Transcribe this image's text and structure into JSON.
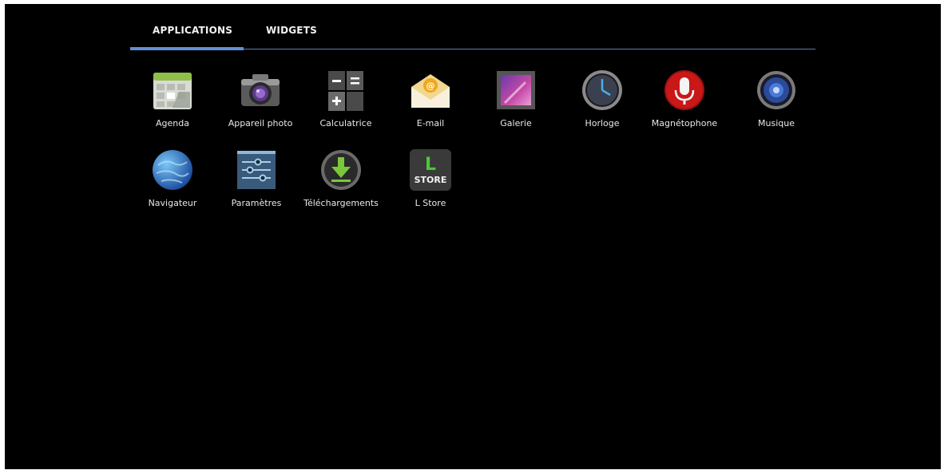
{
  "tabs": [
    {
      "label": "APPLICATIONS",
      "active": true
    },
    {
      "label": "WIDGETS",
      "active": false
    }
  ],
  "accent_color": "#5f8ed8",
  "apps": [
    {
      "label": "Agenda",
      "icon": "calendar-icon"
    },
    {
      "label": "Appareil photo",
      "icon": "camera-icon"
    },
    {
      "label": "Calculatrice",
      "icon": "calculator-icon"
    },
    {
      "label": "E-mail",
      "icon": "email-icon"
    },
    {
      "label": "Galerie",
      "icon": "gallery-icon"
    },
    {
      "label": "Horloge",
      "icon": "clock-icon"
    },
    {
      "label": "Magnétophone",
      "icon": "microphone-icon"
    },
    {
      "label": "Musique",
      "icon": "speaker-icon"
    },
    {
      "label": "Navigateur",
      "icon": "globe-icon"
    },
    {
      "label": "Paramètres",
      "icon": "settings-sliders-icon"
    },
    {
      "label": "Téléchargements",
      "icon": "download-icon"
    },
    {
      "label": "L Store",
      "icon": "store-icon",
      "icon_text": "STORE",
      "icon_letter": "L"
    }
  ]
}
